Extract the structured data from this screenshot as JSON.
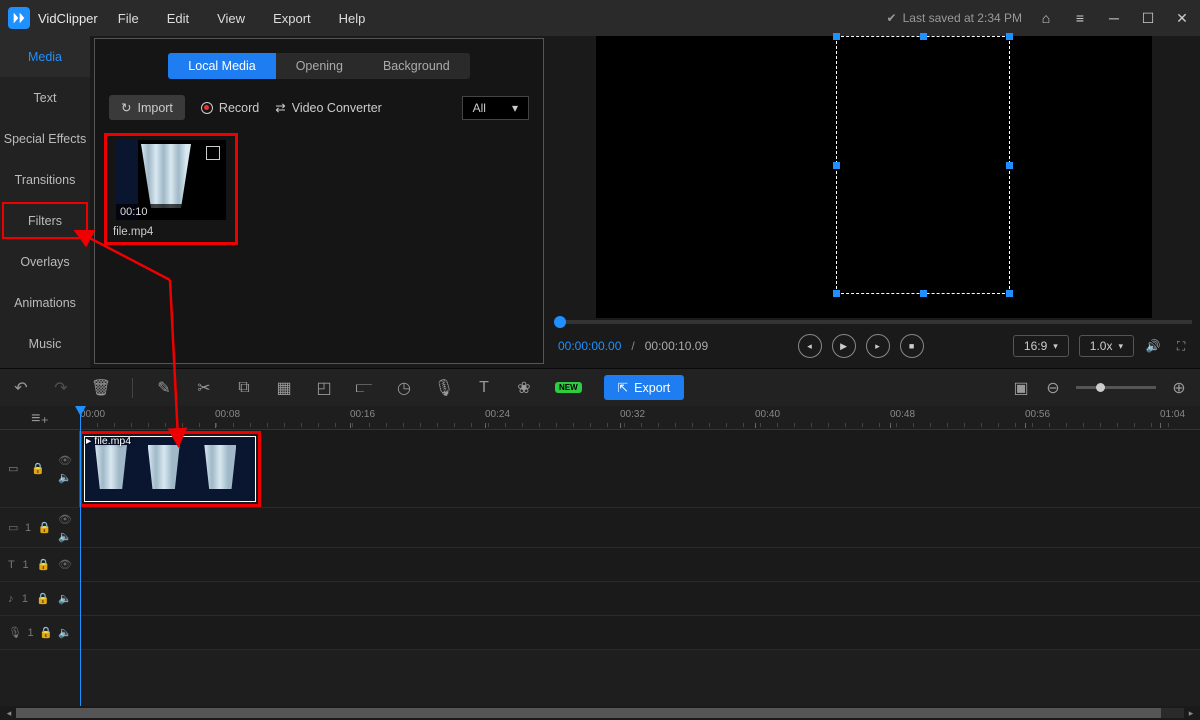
{
  "app": {
    "title": "VidClipper",
    "saved": "Last saved at 2:34 PM"
  },
  "menu": [
    "File",
    "Edit",
    "View",
    "Export",
    "Help"
  ],
  "sidebar": {
    "items": [
      {
        "label": "Media"
      },
      {
        "label": "Text"
      },
      {
        "label": "Special Effects"
      },
      {
        "label": "Transitions"
      },
      {
        "label": "Filters"
      },
      {
        "label": "Overlays"
      },
      {
        "label": "Animations"
      },
      {
        "label": "Music"
      }
    ]
  },
  "media_panel": {
    "tabs": [
      {
        "label": "Local Media"
      },
      {
        "label": "Opening"
      },
      {
        "label": "Background"
      }
    ],
    "actions": {
      "import": "Import",
      "record": "Record",
      "converter": "Video Converter",
      "filter_value": "All"
    },
    "clips": [
      {
        "name": "file.mp4",
        "duration": "00:10"
      }
    ]
  },
  "preview": {
    "time_current": "00:00:00.00",
    "time_total": "00:00:10.09",
    "aspect": "16:9",
    "speed": "1.0x"
  },
  "toolbar": {
    "new": "NEW",
    "export": "Export"
  },
  "timeline": {
    "ticks": [
      "00:00",
      "00:08",
      "00:16",
      "00:24",
      "00:32",
      "00:40",
      "00:48",
      "00:56",
      "01:04"
    ],
    "clip_name": "file.mp4",
    "track2_label": "1",
    "track3_label": "1",
    "track4_label": "1",
    "track5_label": "1"
  }
}
